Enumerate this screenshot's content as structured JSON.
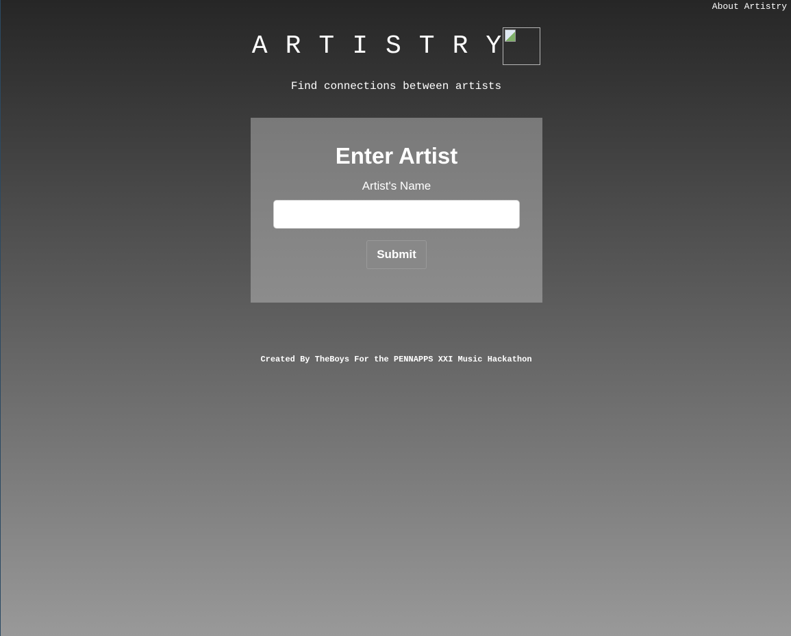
{
  "nav": {
    "about_label": "About Artistry"
  },
  "brand": {
    "title": "ARTISTRY",
    "logo_icon": "broken-image-icon"
  },
  "tagline": "Find connections between artists",
  "form": {
    "heading": "Enter Artist",
    "field_label": "Artist's Name",
    "input_value": "",
    "input_placeholder": "",
    "submit_label": "Submit"
  },
  "footer": {
    "text": "Created By TheBoys For the PENNAPPS XXI Music Hackathon"
  },
  "colors": {
    "background_top": "#262626",
    "background_bottom": "#999999",
    "card_background": "#797979",
    "text": "#ffffff"
  }
}
